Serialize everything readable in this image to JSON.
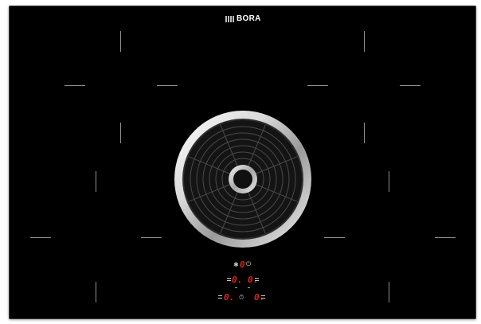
{
  "brand": {
    "name": "BORA"
  },
  "controls": {
    "extractor": {
      "fan_icon": "fan-icon",
      "level": "0",
      "mode_icon": "power-symbol-icon"
    },
    "zones": [
      {
        "id": "front-left",
        "level": "0."
      },
      {
        "id": "front-right",
        "level": "0."
      },
      {
        "id": "rear-left",
        "level": "0."
      },
      {
        "id": "rear-right",
        "level": "0."
      }
    ],
    "timer_icon": "timer-icon"
  },
  "colors": {
    "surface": "#000000",
    "display": "#e2231a",
    "markings": "#8f8f8f",
    "frame": "#ffffff"
  }
}
